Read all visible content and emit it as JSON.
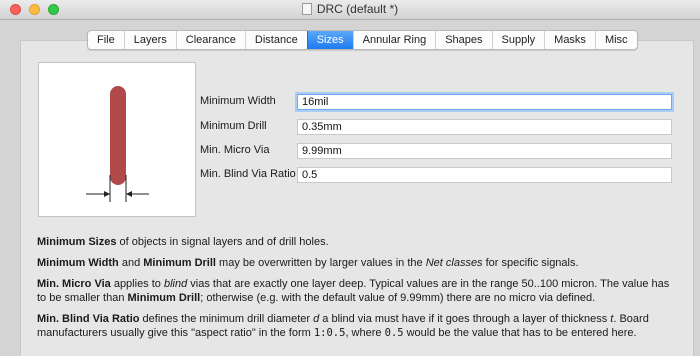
{
  "window": {
    "title": "DRC (default *)"
  },
  "tabs": [
    {
      "label": "File",
      "active": false
    },
    {
      "label": "Layers",
      "active": false
    },
    {
      "label": "Clearance",
      "active": false
    },
    {
      "label": "Distance",
      "active": false
    },
    {
      "label": "Sizes",
      "active": true
    },
    {
      "label": "Annular Ring",
      "active": false
    },
    {
      "label": "Shapes",
      "active": false
    },
    {
      "label": "Supply",
      "active": false
    },
    {
      "label": "Masks",
      "active": false
    },
    {
      "label": "Misc",
      "active": false
    }
  ],
  "form": {
    "min_width_label": "Minimum Width",
    "min_width_value": "16mil",
    "min_drill_label": "Minimum Drill",
    "min_drill_value": "0.35mm",
    "min_micro_via_label": "Min. Micro Via",
    "min_micro_via_value": "9.99mm",
    "min_blind_ratio_label": "Min. Blind Via Ratio",
    "min_blind_ratio_value": "0.5"
  },
  "help": {
    "p1_b1": "Minimum Sizes",
    "p1_t1": " of objects in signal layers and of drill holes.",
    "p2_b1": "Minimum Width",
    "p2_t1": " and ",
    "p2_b2": "Minimum Drill",
    "p2_t2": " may be overwritten by larger values in the ",
    "p2_i1": "Net classes",
    "p2_t3": " for specific signals.",
    "p3_b1": "Min. Micro Via",
    "p3_t1": " applies to ",
    "p3_i1": "blind",
    "p3_t2": " vias that are exactly one layer deep. Typical values are in the range 50..100 micron. The value has to be smaller than ",
    "p3_b2": "Minimum Drill",
    "p3_t3": "; otherwise (e.g. with the default value of 9.99mm) there are no micro via defined.",
    "p4_b1": "Min. Blind Via Ratio",
    "p4_t1": " defines the minimum drill diameter ",
    "p4_i1": "d",
    "p4_t2": " a blind via must have if it goes through a layer of thickness ",
    "p4_i2": "t",
    "p4_t3": ". Board manufacturers usually give this \"aspect ratio\" in the form ",
    "p4_c1": "1:0.5",
    "p4_t4": ", where ",
    "p4_c2": "0.5",
    "p4_t5": " would be the value that has to be entered here."
  },
  "colors": {
    "trace": "#b04a4a",
    "tab_active": "#2a86f4",
    "focus_ring": "#a9ccf8"
  }
}
